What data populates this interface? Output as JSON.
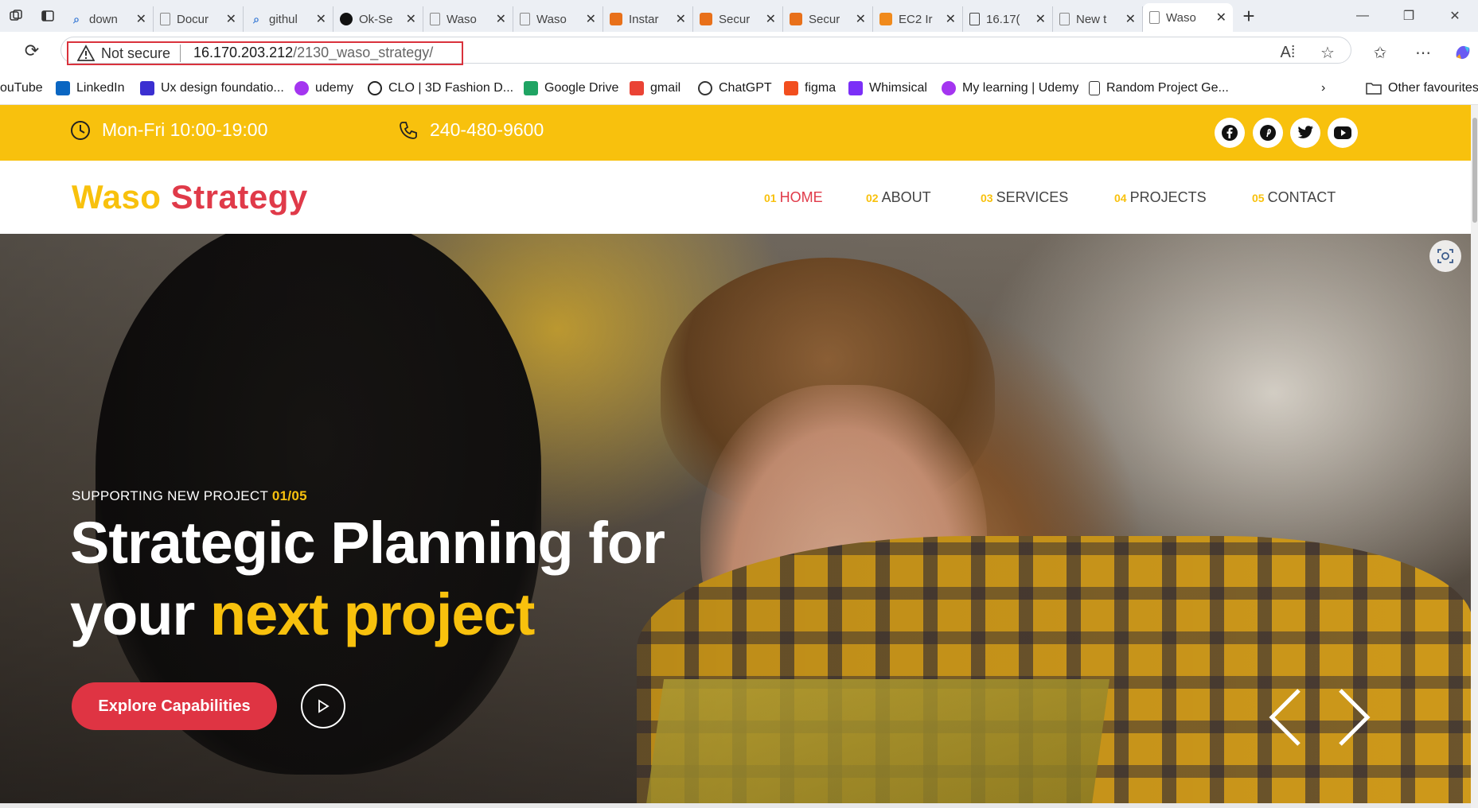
{
  "browser": {
    "tabs": [
      {
        "title": "down",
        "icon": "search-icon",
        "color": "#3a7bd5"
      },
      {
        "title": "Docur",
        "icon": "page-icon",
        "color": "#888888"
      },
      {
        "title": "githul",
        "icon": "search-icon",
        "color": "#3a7bd5"
      },
      {
        "title": "Ok-Se",
        "icon": "github-icon",
        "color": "#111111"
      },
      {
        "title": "Waso",
        "icon": "page-icon",
        "color": "#888888"
      },
      {
        "title": "Waso",
        "icon": "page-icon",
        "color": "#888888"
      },
      {
        "title": "Instar",
        "icon": "aws-console-icon",
        "color": "#e8701a"
      },
      {
        "title": "Secur",
        "icon": "aws-console-icon",
        "color": "#e8701a"
      },
      {
        "title": "Secur",
        "icon": "aws-console-icon",
        "color": "#e8701a"
      },
      {
        "title": "EC2 Ir",
        "icon": "ec2-icon",
        "color": "#f08a1c"
      },
      {
        "title": "16.17(",
        "icon": "page-icon",
        "color": "#444444"
      },
      {
        "title": "New t",
        "icon": "new-tab-icon",
        "color": "#888888"
      },
      {
        "title": "Waso",
        "icon": "page-icon",
        "color": "#888888",
        "active": true
      }
    ],
    "address": {
      "security_label": "Not secure",
      "host": "16.170.203.212",
      "path": "/2130_waso_strategy/"
    },
    "bookmarks": [
      {
        "label": "ouTube",
        "icon": "youtube-icon"
      },
      {
        "label": "LinkedIn",
        "icon": "linkedin-icon"
      },
      {
        "label": "Ux design foundatio...",
        "icon": "ux-design-icon"
      },
      {
        "label": "udemy",
        "icon": "udemy-icon"
      },
      {
        "label": "CLO | 3D Fashion D...",
        "icon": "clo-icon"
      },
      {
        "label": "Google Drive",
        "icon": "google-drive-icon"
      },
      {
        "label": "gmail",
        "icon": "gmail-icon"
      },
      {
        "label": "ChatGPT",
        "icon": "chatgpt-icon"
      },
      {
        "label": "figma",
        "icon": "figma-icon"
      },
      {
        "label": "Whimsical",
        "icon": "whimsical-icon"
      },
      {
        "label": "My learning | Udemy",
        "icon": "udemy-icon"
      },
      {
        "label": "Random Project Ge...",
        "icon": "page-icon"
      }
    ],
    "other_favourites": "Other favourites"
  },
  "site": {
    "topbar": {
      "hours": "Mon-Fri 10:00-19:00",
      "phone": "240-480-9600",
      "socials": [
        "facebook-icon",
        "pinterest-icon",
        "twitter-icon",
        "youtube-icon"
      ]
    },
    "logo": {
      "word1": "Waso",
      "word2": "Strategy"
    },
    "nav": [
      {
        "num": "01",
        "label": "HOME",
        "active": true
      },
      {
        "num": "02",
        "label": "ABOUT"
      },
      {
        "num": "03",
        "label": "SERVICES"
      },
      {
        "num": "04",
        "label": "PROJECTS"
      },
      {
        "num": "05",
        "label": "CONTACT"
      }
    ],
    "hero": {
      "kicker": "SUPPORTING NEW PROJECT",
      "counter": "01/05",
      "title_line1": "Strategic Planning for",
      "title_line2_plain": "your",
      "title_line2_highlight": "next project",
      "cta_label": "Explore Capabilities"
    },
    "colors": {
      "accent_yellow": "#f8c10d",
      "accent_red": "#e03a49"
    }
  }
}
